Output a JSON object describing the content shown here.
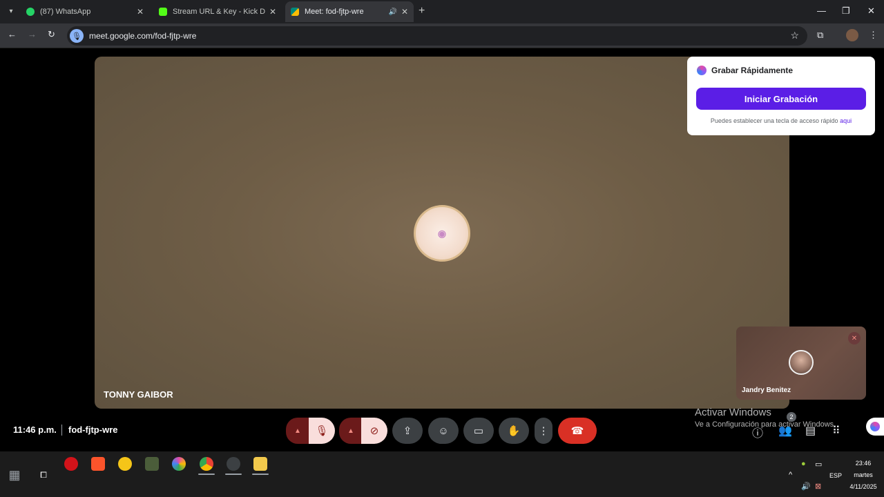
{
  "browser": {
    "tabs": [
      {
        "title": "(87) WhatsApp",
        "icon": "whatsapp-icon",
        "color": "#25d366"
      },
      {
        "title": "Stream URL & Key - Kick Dashb",
        "icon": "kick-icon",
        "color": "#53fc18"
      },
      {
        "title": "Meet: fod-fjtp-wre",
        "icon": "meet-icon",
        "color": "#00897b"
      }
    ],
    "url": "meet.google.com/fod-fjtp-wre"
  },
  "meet": {
    "main_participant": "TONNY GAIBOR",
    "pip_participant": "Jandry Benitez",
    "time": "11:46 p.m.",
    "meeting_code": "fod-fjtp-wre",
    "participants_count": "2"
  },
  "recorder": {
    "title": "Grabar Rápidamente",
    "button": "Iniciar Grabación",
    "hint": "Puedes establecer una tecla de acceso rápido",
    "hint_link": "aqui"
  },
  "watermark": {
    "line1": "Activar Windows",
    "line2": "Ve a Configuración para activar Windows."
  },
  "taskbar": {
    "language": "ESP",
    "clock_time": "23:46",
    "clock_day": "martes",
    "clock_date": "4/11/2025"
  },
  "colors": {
    "accent_purple": "#5b1ee6",
    "end_call_red": "#d93025"
  }
}
